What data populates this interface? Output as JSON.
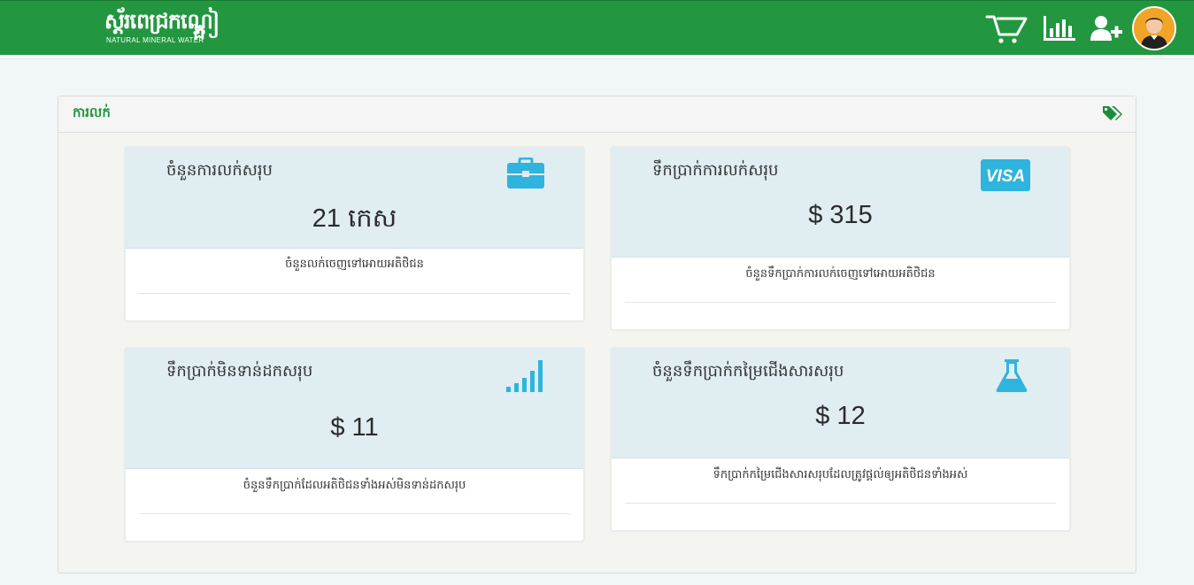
{
  "header": {
    "brand_text": "ស្ត័រពេជ្រកណ្តៀ",
    "brand_tail": "ង",
    "brand_sub": "NATURAL MINERAL WATER",
    "icons": [
      "cart-icon",
      "bar-chart-icon",
      "add-user-icon",
      "user-avatar"
    ]
  },
  "panel": {
    "title": "ការលក់",
    "icon": "tags-icon"
  },
  "cards": [
    {
      "label": "ចំនួនការលក់សរុប",
      "value": "21 កេស",
      "description": "ចំនួនលក់ចេញទៅអោយអតិថិជន",
      "icon": "briefcase-icon"
    },
    {
      "label": "ទឹកប្រាក់ការលក់សរុប",
      "value": "$ 315",
      "description": "ចំនួនទឹកប្រាក់ការលក់ចេញទៅអោយអតិថិជន",
      "icon": "visa-icon"
    },
    {
      "label": "ទឹកប្រាក់មិនទាន់ដកសរុប",
      "value": "$ 11",
      "description": "ចំនួនទឹកប្រាក់ដែលអតិថិជនទាំងអស់មិនទាន់ដកសរុប",
      "icon": "signal-bars-icon"
    },
    {
      "label": "ចំនួនទឹកប្រាក់កម្រៃជើងសារសរុប",
      "value": "$ 12",
      "description": "ទឹកប្រាក់កម្រៃជើងសារសរុបដែលត្រូវផ្តល់ឲ្យអតិថិជនទាំងអស់",
      "icon": "flask-icon"
    }
  ],
  "colors": {
    "header_green": "#22973f",
    "card_header_bg": "#e0edf1",
    "icon_blue": "#2fb4de",
    "tag_green": "#1f8c3a"
  }
}
